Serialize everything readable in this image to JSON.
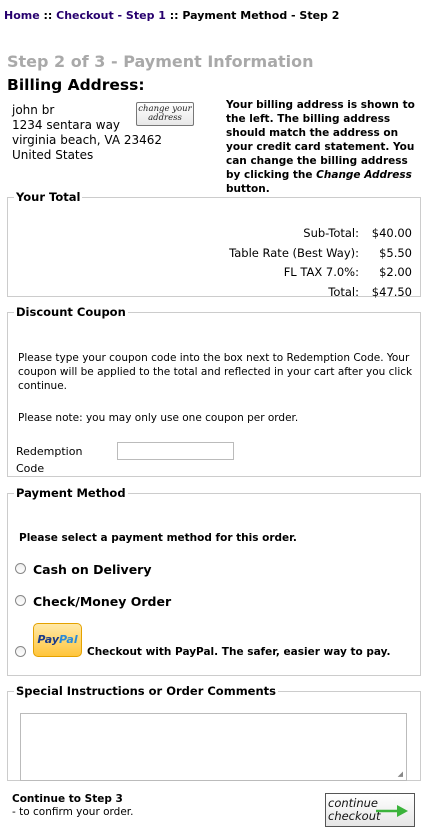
{
  "breadcrumb": {
    "home": "Home",
    "sep1": " :: ",
    "checkout": "Checkout - Step 1",
    "sep2": " :: ",
    "current": "Payment Method - Step 2"
  },
  "page_title": "Step 2 of 3 - Payment Information",
  "billing": {
    "heading": "Billing Address:",
    "name": "john br",
    "street": "1234 sentara way",
    "city": "virginia beach, VA 23462",
    "country": "United States",
    "change_btn_line1": "change your",
    "change_btn_line2": "address",
    "note_part1": "Your billing address is shown to the left. The billing address should match the address on your credit card statement. You can change the billing address by clicking the ",
    "note_italic": "Change Address",
    "note_part2": " button."
  },
  "totals": {
    "legend": "Your Total",
    "rows": [
      {
        "label": "Sub-Total:",
        "value": "$40.00"
      },
      {
        "label": "Table Rate (Best Way):",
        "value": "$5.50"
      },
      {
        "label": "FL TAX 7.0%:",
        "value": "$2.00"
      },
      {
        "label": "Total:",
        "value": "$47.50"
      }
    ]
  },
  "coupon": {
    "legend": "Discount Coupon",
    "text": "Please type your coupon code into the box next to Redemption Code. Your coupon will be applied to the total and reflected in your cart after you click continue.",
    "note": "Please note: you may only use one coupon per order.",
    "redemption_label": "Redemption Code",
    "redemption_value": ""
  },
  "payment": {
    "legend": "Payment Method",
    "instruction": "Please select a payment method for this order.",
    "cod": "Cash on Delivery",
    "check": "Check/Money Order",
    "paypal_logo_pay": "Pay",
    "paypal_logo_pal": "Pal",
    "paypal_text": "Checkout with PayPal. The safer, easier way to pay."
  },
  "comments": {
    "legend": "Special Instructions or Order Comments",
    "value": ""
  },
  "continue": {
    "title": "Continue to Step 3",
    "subtitle": "- to confirm your order.",
    "btn_line1": "continue",
    "btn_line2": "checkout"
  },
  "colors": {
    "link": "#27006e",
    "step_title": "#a9a9a9",
    "border": "#cccccc",
    "arrow": "#3bb33b"
  }
}
